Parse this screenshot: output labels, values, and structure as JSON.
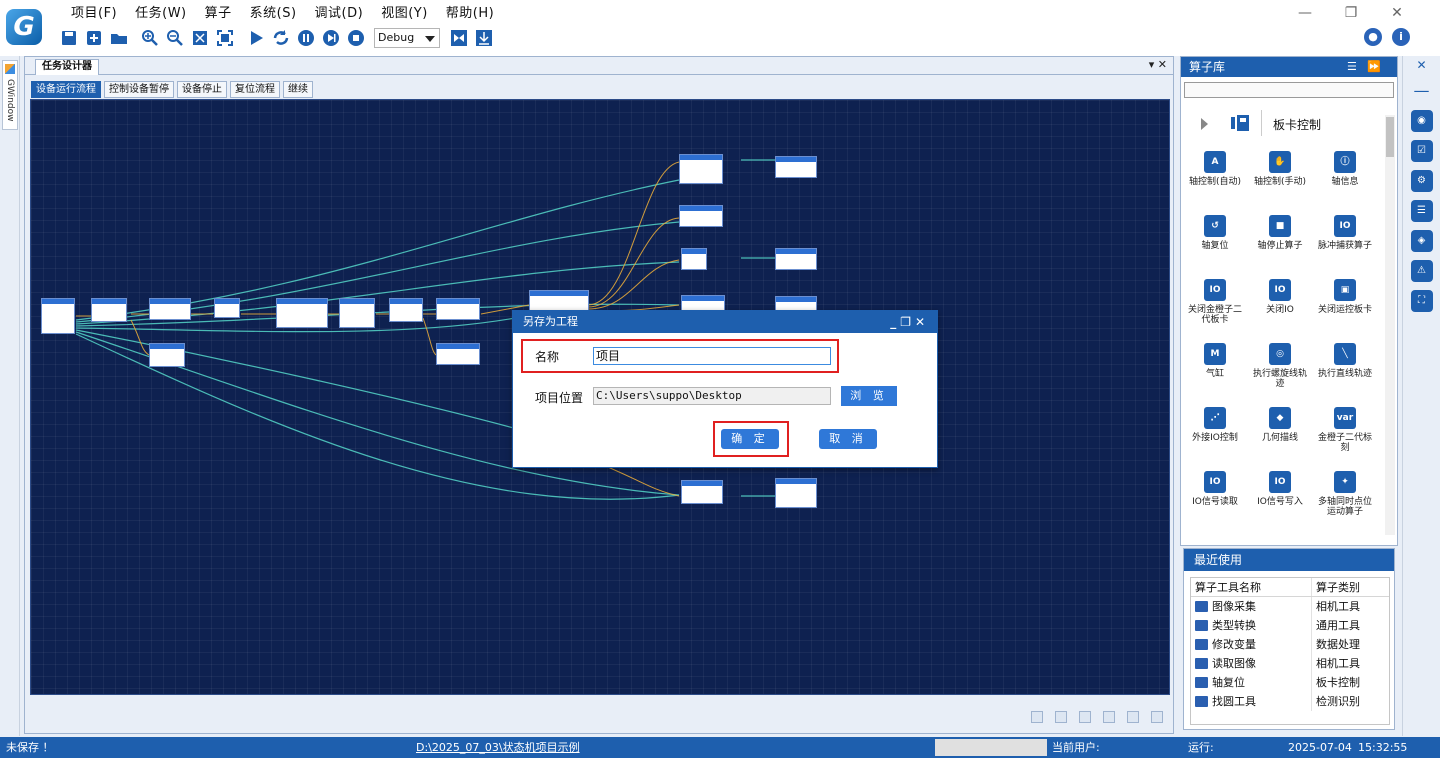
{
  "menu": [
    "项目(F)",
    "任务(W)",
    "算子",
    "系统(S)",
    "调试(D)",
    "视图(Y)",
    "帮助(H)"
  ],
  "toolbar": {
    "run_mode": "Debug"
  },
  "window_controls": [
    "—",
    "❐",
    "✕"
  ],
  "left_tab": "GWindow",
  "designer": {
    "title": "任务设计器",
    "controls": "▾ ✕",
    "tabs": [
      "设备运行流程",
      "控制设备暂停",
      "设备停止",
      "复位流程",
      "继续"
    ]
  },
  "library": {
    "title": "算子库",
    "category": "板卡控制",
    "operators": [
      {
        "label": "轴控制(自动)",
        "icon": "A"
      },
      {
        "label": "轴控制(手动)",
        "icon": "✋"
      },
      {
        "label": "轴信息",
        "icon": "ⓘ"
      },
      {
        "label": "轴复位",
        "icon": "↺"
      },
      {
        "label": "轴停止算子",
        "icon": "■"
      },
      {
        "label": "脉冲捕获算子",
        "icon": "IO"
      },
      {
        "label": "关闭金橙子二代板卡",
        "icon": "IO"
      },
      {
        "label": "关闭IO",
        "icon": "IO"
      },
      {
        "label": "关闭运控板卡",
        "icon": "▣"
      },
      {
        "label": "气缸",
        "icon": "M"
      },
      {
        "label": "执行螺旋线轨迹",
        "icon": "◎"
      },
      {
        "label": "执行直线轨迹",
        "icon": "╲"
      },
      {
        "label": "外接IO控制",
        "icon": "⋰"
      },
      {
        "label": "几何描线",
        "icon": "◆"
      },
      {
        "label": "金橙子二代标刻",
        "icon": "var"
      },
      {
        "label": "IO信号读取",
        "icon": "IO"
      },
      {
        "label": "IO信号写入",
        "icon": "IO"
      },
      {
        "label": "多轴同时点位运动算子",
        "icon": "✦"
      }
    ]
  },
  "recent": {
    "title": "最近使用",
    "headers": [
      "算子工具名称",
      "算子类别"
    ],
    "rows": [
      {
        "name": "图像采集",
        "type": "相机工具"
      },
      {
        "name": "类型转换",
        "type": "通用工具"
      },
      {
        "name": "修改变量",
        "type": "数据处理"
      },
      {
        "name": "读取图像",
        "type": "相机工具"
      },
      {
        "name": "轴复位",
        "type": "板卡控制"
      },
      {
        "name": "找圆工具",
        "type": "检测识别"
      }
    ]
  },
  "dialog": {
    "title": "另存为工程",
    "name_label": "名称",
    "name_value": "项目",
    "location_label": "项目位置",
    "location_value": "C:\\Users\\suppo\\Desktop",
    "browse": "浏 览",
    "ok": "确 定",
    "cancel": "取 消",
    "controls": "_❐✕"
  },
  "status": {
    "save_state": "未保存 ！",
    "project_path": "D:\\2025_07_03\\状态机项目示例",
    "user_label": "当前用户:",
    "run_label": "运行:",
    "date": "2025-07-04",
    "time": "15:32:55"
  },
  "colors": {
    "accent": "#1e5fae",
    "canvas": "#0e2150",
    "highlight": "#e02020"
  }
}
